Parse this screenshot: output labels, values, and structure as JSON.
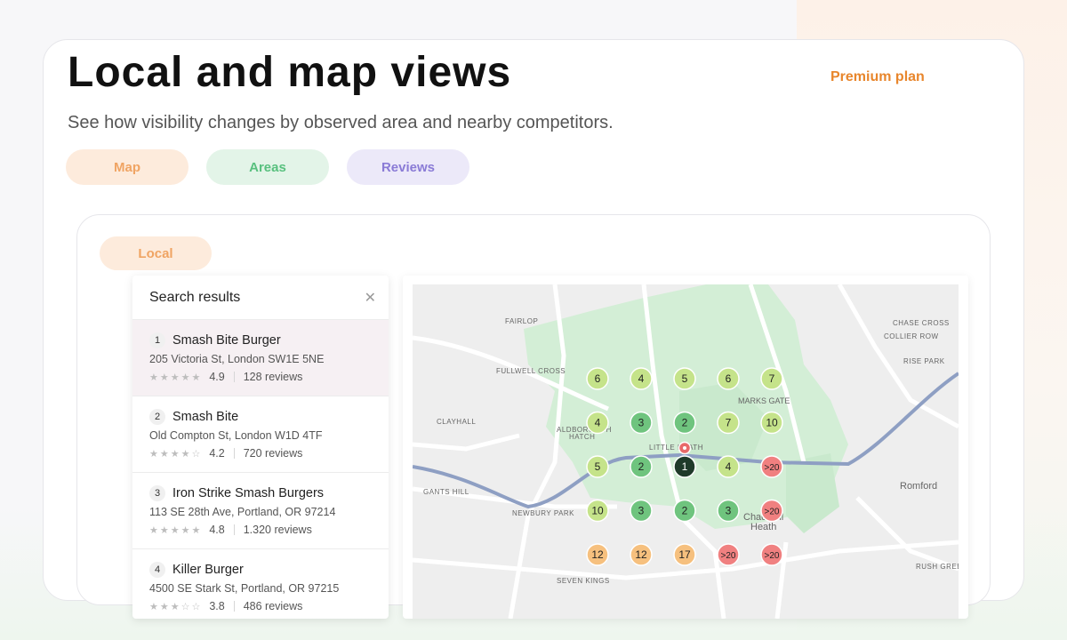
{
  "header": {
    "title": "Local and map views",
    "subtitle": "See how visibility changes by observed area and nearby competitors.",
    "plan_badge": "Premium plan"
  },
  "tabs": [
    {
      "label": "Map",
      "color": "#f0a463"
    },
    {
      "label": "Areas",
      "color": "#58c07e"
    },
    {
      "label": "Reviews",
      "color": "#8a7bd6"
    }
  ],
  "local_tab": {
    "label": "Local"
  },
  "search_results": {
    "title": "Search results",
    "close_icon": "close-icon",
    "items": [
      {
        "rank": "1",
        "name": "Smash Bite Burger",
        "address": "205 Victoria St, London SW1E 5NE",
        "rating": "4.9",
        "stars": 5,
        "reviews": "128 reviews"
      },
      {
        "rank": "2",
        "name": "Smash Bite",
        "address": "Old Compton St, London W1D 4TF",
        "rating": "4.2",
        "stars": 4,
        "reviews": "720 reviews"
      },
      {
        "rank": "3",
        "name": "Iron Strike Smash Burgers",
        "address": "113 SE 28th Ave, Portland, OR 97214",
        "rating": "4.8",
        "stars": 5,
        "reviews": "1.320 reviews"
      },
      {
        "rank": "4",
        "name": "Killer Burger",
        "address": "4500 SE Stark St, Portland, OR 97215",
        "rating": "3.8",
        "stars": 3,
        "reviews": "486 reviews"
      }
    ]
  },
  "map": {
    "place_labels": [
      "FAIRLOP",
      "FULLWELL CROSS",
      "CLAYHALL",
      "ALDBOROUGH HATCH",
      "LITTLE HEATH",
      "GANTS HILL",
      "NEWBURY PARK",
      "SEVEN KINGS",
      "MARKS GATE",
      "CHASE CROSS",
      "COLLIER ROW",
      "RISE PARK",
      "Romford",
      "Chadwell Heath",
      "RUSH GREEN"
    ],
    "rank_grid": [
      [
        "6",
        "4",
        "5",
        "6",
        "7"
      ],
      [
        "4",
        "3",
        "2",
        "7",
        "10"
      ],
      [
        "5",
        "2",
        "1",
        "4",
        ">20"
      ],
      [
        "10",
        "3",
        "2",
        "3",
        ">20"
      ],
      [
        "12",
        "12",
        "17",
        ">20",
        ">20"
      ]
    ],
    "colors": {
      "light_green": "#c5e38a",
      "mid_green": "#6fc47e",
      "dark": "#1f3a2a",
      "orange": "#f6c07e",
      "red": "#f08080"
    }
  }
}
